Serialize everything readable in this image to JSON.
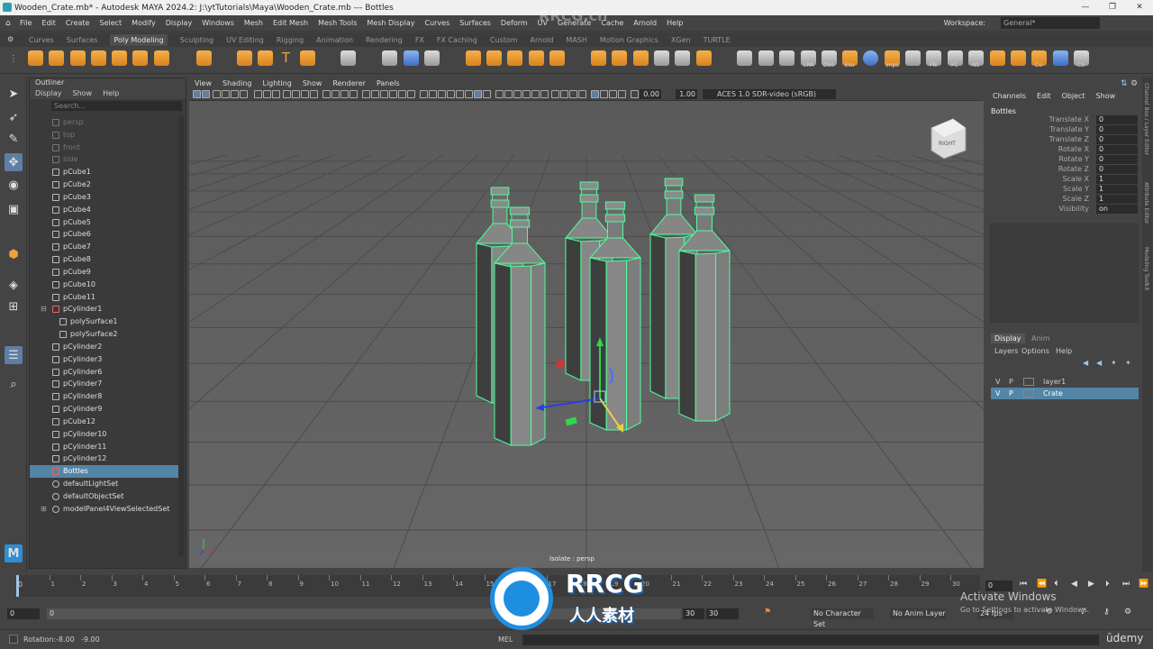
{
  "window": {
    "title": "Wooden_Crate.mb* - Autodesk MAYA 2024.2: J:\\ytTutorials\\Maya\\Wooden_Crate.mb  ---  Bottles",
    "minimize": "—",
    "maximize": "❐",
    "close": "✕"
  },
  "menubar": {
    "items": [
      "File",
      "Edit",
      "Create",
      "Select",
      "Modify",
      "Display",
      "Windows",
      "Mesh",
      "Edit Mesh",
      "Mesh Tools",
      "Mesh Display",
      "Curves",
      "Surfaces",
      "Deform",
      "UV",
      "Generate",
      "Cache",
      "Arnold",
      "Help"
    ],
    "workspace_label": "Workspace:",
    "workspace_value": "General*"
  },
  "shelf": {
    "tabs": [
      "Curves",
      "Surfaces",
      "Poly Modeling",
      "Sculpting",
      "UV Editing",
      "Rigging",
      "Animation",
      "Rendering",
      "FX",
      "FX Caching",
      "Custom",
      "Arnold",
      "MASH",
      "Motion Graphics",
      "XGen",
      "TURTLE"
    ],
    "active_tab": "Poly Modeling",
    "labels": [
      "LRA",
      "DSo",
      "Eso",
      "Impo",
      "FN",
      "FC",
      "NS",
      "Co",
      "CS"
    ]
  },
  "outliner": {
    "title": "Outliner",
    "menu": [
      "Display",
      "Show",
      "Help"
    ],
    "search_placeholder": "Search...",
    "items": [
      {
        "label": "persp",
        "kind": "cam",
        "indent": 0,
        "dim": true
      },
      {
        "label": "top",
        "kind": "cam",
        "indent": 0,
        "dim": true
      },
      {
        "label": "front",
        "kind": "cam",
        "indent": 0,
        "dim": true
      },
      {
        "label": "side",
        "kind": "cam",
        "indent": 0,
        "dim": true
      },
      {
        "label": "pCube1",
        "kind": "mesh",
        "indent": 0
      },
      {
        "label": "pCube2",
        "kind": "mesh",
        "indent": 0
      },
      {
        "label": "pCube3",
        "kind": "mesh",
        "indent": 0
      },
      {
        "label": "pCube4",
        "kind": "mesh",
        "indent": 0
      },
      {
        "label": "pCube5",
        "kind": "mesh",
        "indent": 0
      },
      {
        "label": "pCube6",
        "kind": "mesh",
        "indent": 0
      },
      {
        "label": "pCube7",
        "kind": "mesh",
        "indent": 0
      },
      {
        "label": "pCube8",
        "kind": "mesh",
        "indent": 0
      },
      {
        "label": "pCube9",
        "kind": "mesh",
        "indent": 0
      },
      {
        "label": "pCube10",
        "kind": "mesh",
        "indent": 0
      },
      {
        "label": "pCube11",
        "kind": "mesh",
        "indent": 0
      },
      {
        "label": "pCylinder1",
        "kind": "group",
        "indent": 0,
        "expanded": true
      },
      {
        "label": "polySurface1",
        "kind": "mesh",
        "indent": 1
      },
      {
        "label": "polySurface2",
        "kind": "mesh",
        "indent": 1
      },
      {
        "label": "pCylinder2",
        "kind": "mesh",
        "indent": 0
      },
      {
        "label": "pCylinder3",
        "kind": "mesh",
        "indent": 0
      },
      {
        "label": "pCylinder6",
        "kind": "mesh",
        "indent": 0
      },
      {
        "label": "pCylinder7",
        "kind": "mesh",
        "indent": 0
      },
      {
        "label": "pCylinder8",
        "kind": "mesh",
        "indent": 0
      },
      {
        "label": "pCylinder9",
        "kind": "mesh",
        "indent": 0
      },
      {
        "label": "pCube12",
        "kind": "mesh",
        "indent": 0
      },
      {
        "label": "pCylinder10",
        "kind": "mesh",
        "indent": 0
      },
      {
        "label": "pCylinder11",
        "kind": "mesh",
        "indent": 0
      },
      {
        "label": "pCylinder12",
        "kind": "mesh",
        "indent": 0
      },
      {
        "label": "Bottles",
        "kind": "group",
        "indent": 0,
        "selected": true
      },
      {
        "label": "defaultLightSet",
        "kind": "set",
        "indent": 0
      },
      {
        "label": "defaultObjectSet",
        "kind": "set",
        "indent": 0
      },
      {
        "label": "modelPanel4ViewSelectedSet",
        "kind": "set",
        "indent": 0,
        "collapsed": true
      }
    ]
  },
  "viewport": {
    "menus": [
      "View",
      "Shading",
      "Lighting",
      "Show",
      "Renderer",
      "Panels"
    ],
    "exposure": "0.00",
    "gamma": "1.00",
    "color_space": "ACES 1.0 SDR-video (sRGB)",
    "status": "Isolate : persp",
    "viewcube_label": "RIGHT"
  },
  "channel_box": {
    "tabs": [
      "Channels",
      "Edit",
      "Object",
      "Show"
    ],
    "object_name": "Bottles",
    "attributes": [
      {
        "name": "Translate X",
        "value": "0"
      },
      {
        "name": "Translate Y",
        "value": "0"
      },
      {
        "name": "Translate Z",
        "value": "0"
      },
      {
        "name": "Rotate X",
        "value": "0"
      },
      {
        "name": "Rotate Y",
        "value": "0"
      },
      {
        "name": "Rotate Z",
        "value": "0"
      },
      {
        "name": "Scale X",
        "value": "1"
      },
      {
        "name": "Scale Y",
        "value": "1"
      },
      {
        "name": "Scale Z",
        "value": "1"
      },
      {
        "name": "Visibility",
        "value": "on"
      }
    ]
  },
  "side_tabs": [
    "Channel Box / Layer Editor",
    "Attribute Editor",
    "Modeling Toolkit"
  ],
  "layer_editor": {
    "tabs": [
      "Display",
      "Anim"
    ],
    "menu": [
      "Layers",
      "Options",
      "Help"
    ],
    "layers": [
      {
        "v": "V",
        "p": "P",
        "name": "layer1",
        "selected": false
      },
      {
        "v": "V",
        "p": "P",
        "name": "Crate",
        "selected": true
      }
    ]
  },
  "timeline": {
    "ticks": [
      "1",
      "2",
      "3",
      "4",
      "5",
      "6",
      "7",
      "8",
      "9",
      "10",
      "11",
      "12",
      "13",
      "14",
      "15",
      "16",
      "17",
      "18",
      "19",
      "20",
      "21",
      "22",
      "23",
      "24",
      "25",
      "26",
      "27",
      "28",
      "29",
      "30"
    ],
    "current_frame_left": "0",
    "current_frame_right": "0"
  },
  "range": {
    "start": "0",
    "inner_start": "0",
    "inner_end": "30",
    "end": "30",
    "character_set": "No Character Set",
    "anim_layer": "No Anim Layer",
    "fps": "24 fps"
  },
  "status": {
    "rotation_label": "Rotation:",
    "rotation_x": "-8.00",
    "rotation_y": "-9.00",
    "cmd_lang": "MEL"
  },
  "overlays": {
    "activate_title": "Activate Windows",
    "activate_sub": "Go to Settings to activate Windows.",
    "watermark_top": "RRCG.cn",
    "logo_main": "RRCG",
    "logo_sub": "人人素材",
    "udemy": "ūdemy"
  },
  "colors": {
    "selection_blue": "#5285a6",
    "mesh_green": "#4cff9a",
    "shelf_orange": "#e8962e"
  }
}
